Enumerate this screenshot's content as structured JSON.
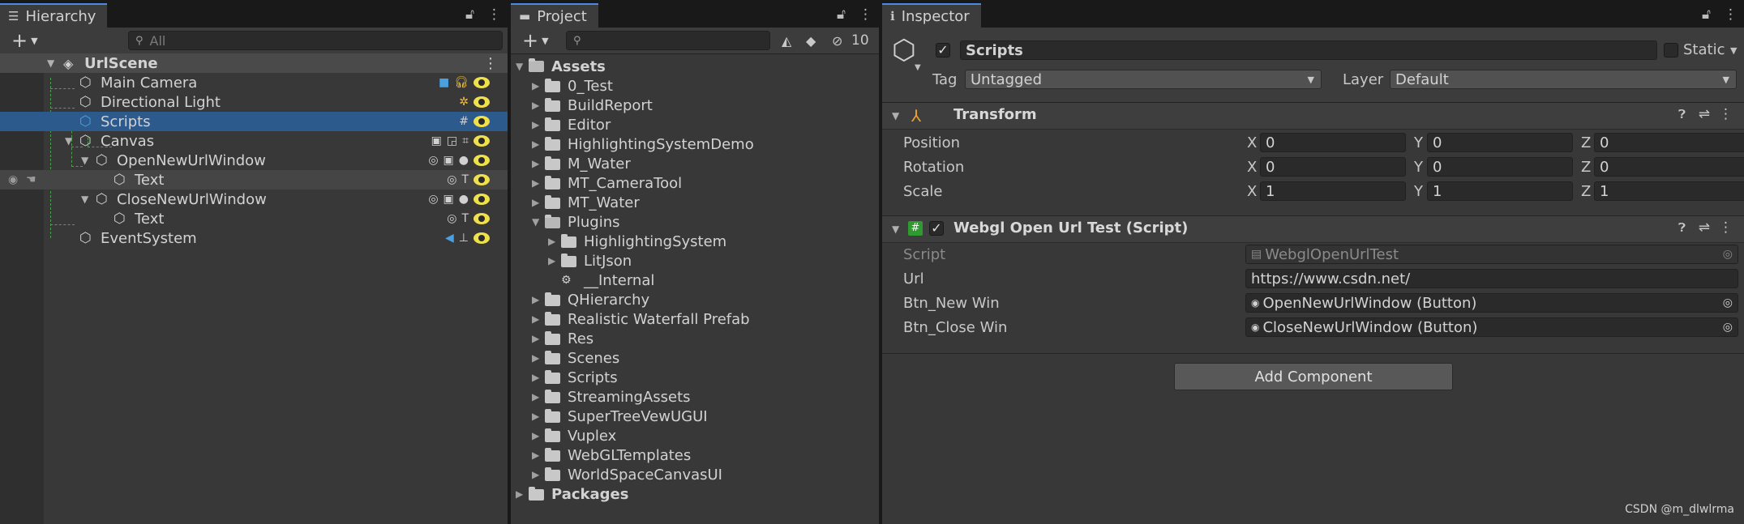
{
  "hierarchy": {
    "tab": "Hierarchy",
    "search_placeholder": "All",
    "scene": "UrlScene",
    "items": [
      {
        "label": "Main Camera"
      },
      {
        "label": "Directional Light"
      },
      {
        "label": "Scripts"
      },
      {
        "label": "Canvas"
      },
      {
        "label": "OpenNewUrlWindow"
      },
      {
        "label": "Text"
      },
      {
        "label": "CloseNewUrlWindow"
      },
      {
        "label": "Text"
      },
      {
        "label": "EventSystem"
      }
    ]
  },
  "project": {
    "tab": "Project",
    "hidden_count": "10",
    "root": "Assets",
    "folders": [
      "0_Test",
      "BuildReport",
      "Editor",
      "HighlightingSystemDemo",
      "M_Water",
      "MT_CameraTool",
      "MT_Water",
      "Plugins"
    ],
    "plugin_children": [
      "HighlightingSystem",
      "LitJson",
      "__Internal"
    ],
    "more_folders": [
      "QHierarchy",
      "Realistic Waterfall Prefab",
      "Res",
      "Scenes",
      "Scripts",
      "StreamingAssets",
      "SuperTreeVewUGUI",
      "Vuplex",
      "WebGLTemplates",
      "WorldSpaceCanvasUI"
    ],
    "packages": "Packages"
  },
  "inspector": {
    "tab": "Inspector",
    "object_name": "Scripts",
    "static_label": "Static",
    "tag_label": "Tag",
    "tag_value": "Untagged",
    "layer_label": "Layer",
    "layer_value": "Default",
    "transform": {
      "title": "Transform",
      "position_label": "Position",
      "rotation_label": "Rotation",
      "scale_label": "Scale",
      "x": "X",
      "y": "Y",
      "z": "Z",
      "position": [
        "0",
        "0",
        "0"
      ],
      "rotation": [
        "0",
        "0",
        "0"
      ],
      "scale": [
        "1",
        "1",
        "1"
      ]
    },
    "script_comp": {
      "title": "Webgl Open Url Test (Script)",
      "script_label": "Script",
      "script_value": "WebglOpenUrlTest",
      "url_label": "Url",
      "url_value": "https://www.csdn.net/",
      "btn_new_label": "Btn_New Win",
      "btn_new_value": "OpenNewUrlWindow (Button)",
      "btn_close_label": "Btn_Close Win",
      "btn_close_value": "CloseNewUrlWindow (Button)"
    },
    "add_component": "Add Component"
  },
  "watermark": "CSDN @m_dlwlrma"
}
